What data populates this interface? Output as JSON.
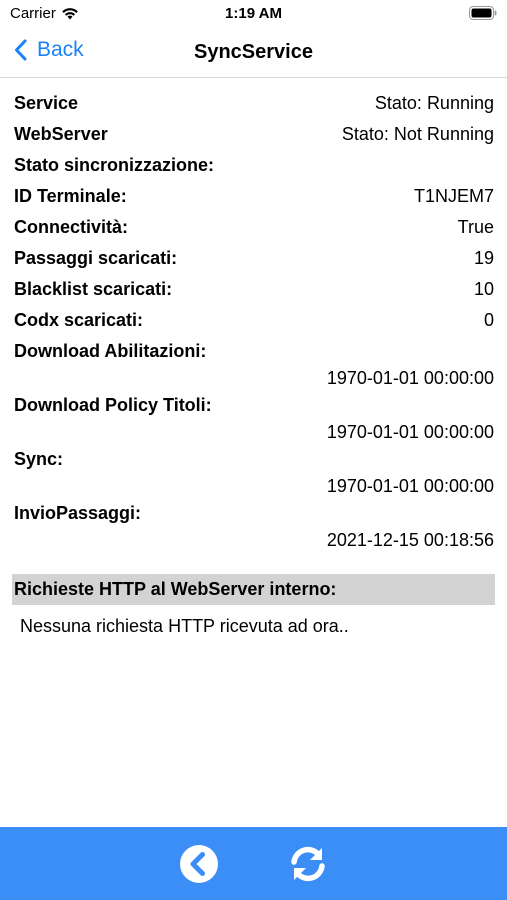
{
  "status_bar": {
    "carrier": "Carrier",
    "time": "1:19 AM"
  },
  "nav": {
    "back_label": "Back",
    "title": "SyncService"
  },
  "rows": [
    {
      "label": "Service",
      "value": "Stato: Running"
    },
    {
      "label": "WebServer",
      "value": "Stato: Not Running"
    },
    {
      "label": "Stato sincronizzazione:",
      "value": ""
    },
    {
      "label": "ID Terminale:",
      "value": "T1NJEM7"
    },
    {
      "label": "Connectività:",
      "value": "True"
    },
    {
      "label": "Passaggi scaricati:",
      "value": "19"
    },
    {
      "label": "Blacklist scaricati:",
      "value": "10"
    },
    {
      "label": "Codx scaricati:",
      "value": "0"
    }
  ],
  "downloads": [
    {
      "label": "Download Abilitazioni:",
      "value": "1970-01-01 00:00:00"
    },
    {
      "label": "Download Policy Titoli:",
      "value": "1970-01-01 00:00:00"
    },
    {
      "label": "Sync:",
      "value": "1970-01-01 00:00:00"
    },
    {
      "label": "InvioPassaggi:",
      "value": "2021-12-15 00:18:56"
    }
  ],
  "http": {
    "header": "Richieste HTTP al WebServer interno:",
    "message": "Nessuna richiesta HTTP ricevuta ad ora.."
  },
  "colors": {
    "accent": "#1a82fb",
    "toolbar": "#3a8ef6",
    "section_header": "#d3d3d3"
  },
  "icons": {
    "back_chevron": "chevron-left-icon",
    "toolbar_back": "circle-chevron-left-icon",
    "toolbar_refresh": "refresh-icon"
  }
}
